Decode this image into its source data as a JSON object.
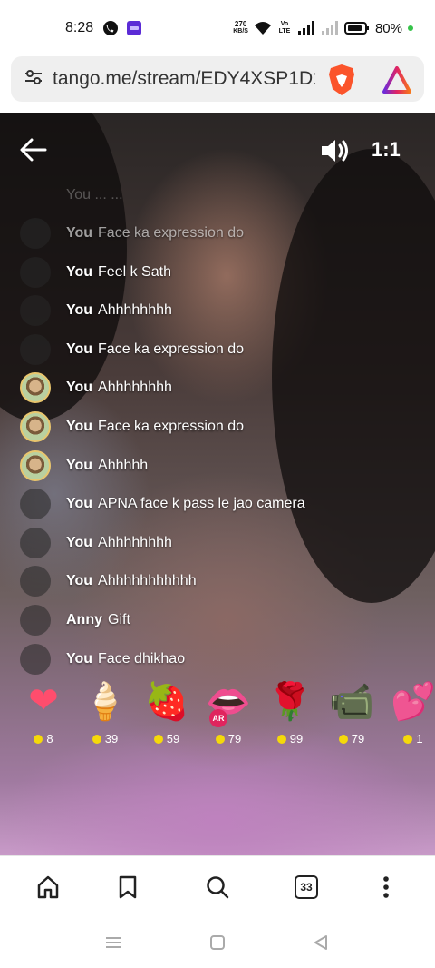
{
  "status": {
    "time": "8:28",
    "net_speed_value": "270",
    "net_speed_unit": "KB/S",
    "volte": "Vo LTE",
    "battery": "80%"
  },
  "browser": {
    "url": "tango.me/stream/EDY4XSP1D1",
    "tab_count": "33"
  },
  "stream": {
    "ratio_label": "1:1",
    "faded_message": "You   ...   ...",
    "messages": [
      {
        "user": "You",
        "text": "Face ka expression do",
        "avatar": "dark",
        "dim": true
      },
      {
        "user": "You",
        "text": "Feel k Sath",
        "avatar": "dark",
        "dim": false
      },
      {
        "user": "You",
        "text": "Ahhhhhhhh",
        "avatar": "dark",
        "dim": false
      },
      {
        "user": "You",
        "text": "Face ka expression do",
        "avatar": "dark",
        "dim": false
      },
      {
        "user": "You",
        "text": "Ahhhhhhhh",
        "avatar": "photo",
        "dim": false
      },
      {
        "user": "You",
        "text": "Face ka expression do",
        "avatar": "photo",
        "dim": false
      },
      {
        "user": "You",
        "text": "Ahhhhh",
        "avatar": "photo",
        "dim": false
      },
      {
        "user": "You",
        "text": "APNA face k pass le jao camera",
        "avatar": "dark",
        "dim": false
      },
      {
        "user": "You",
        "text": "Ahhhhhhhh",
        "avatar": "dark",
        "dim": false
      },
      {
        "user": "You",
        "text": "Ahhhhhhhhhhh",
        "avatar": "dark",
        "dim": false
      },
      {
        "user": "Anny",
        "text": "Gift",
        "avatar": "dark",
        "dim": false
      },
      {
        "user": "You",
        "text": "Face dhikhao",
        "avatar": "dark",
        "dim": false
      }
    ],
    "gifts": [
      {
        "name": "heart-gift",
        "glyph": "❤",
        "price": "8"
      },
      {
        "name": "ice-cream-gift",
        "glyph": "🍦",
        "price": "39"
      },
      {
        "name": "chocolate-strawberry-gift",
        "glyph": "🍓",
        "price": "59"
      },
      {
        "name": "lips-gift",
        "glyph": "👄",
        "price": "79",
        "badge": "AR"
      },
      {
        "name": "rose-gift",
        "glyph": "🌹",
        "price": "99"
      },
      {
        "name": "video-camera-gift",
        "glyph": "📹",
        "price": "79"
      },
      {
        "name": "hearts-gift",
        "glyph": "💕",
        "price": "1"
      }
    ]
  },
  "colors": {
    "coin": "#f5d90a",
    "brave_orange": "#fb542b",
    "ar_badge": "#e0245e"
  }
}
